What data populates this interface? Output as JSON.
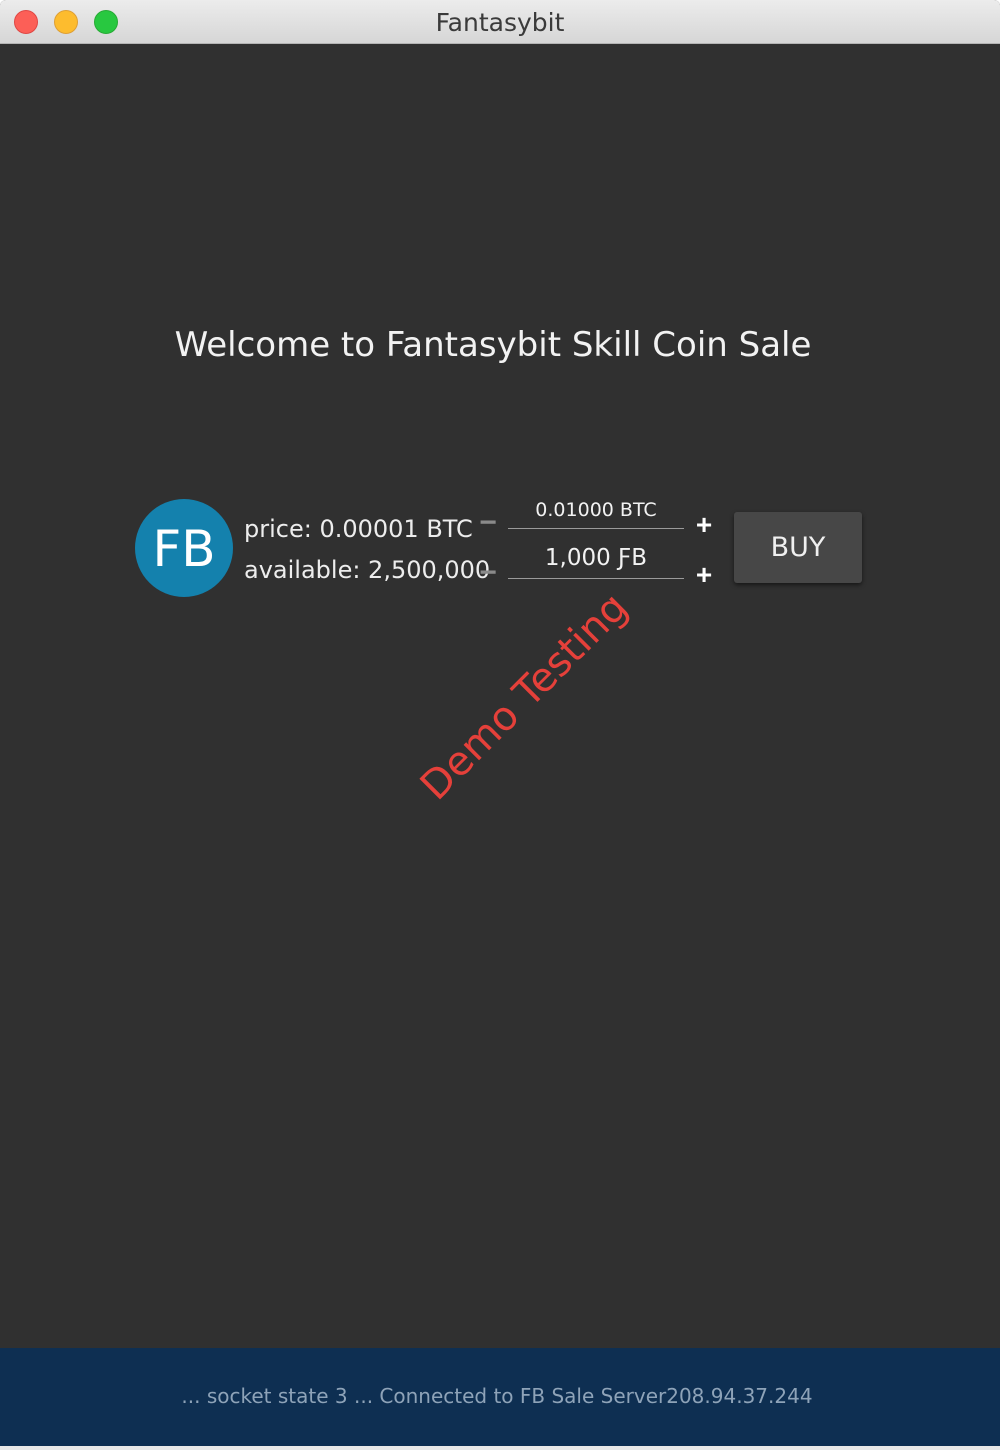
{
  "window": {
    "title": "Fantasybit"
  },
  "main": {
    "welcome": "Welcome to Fantasybit Skill Coin Sale",
    "logo_text": "FB",
    "price_label": "price: 0.00001 BTC",
    "available_label": "available: 2,500,000",
    "btc_amount": "0.01000 BTC",
    "fb_amount": "1,000 ƑB",
    "minus_symbol": "−",
    "plus_symbol": "+",
    "buy_label": "BUY",
    "watermark": "Demo Testing"
  },
  "status": {
    "text": "... socket state 3  ... Connected to FB Sale Server208.94.37.244"
  },
  "colors": {
    "background": "#303030",
    "status_bar": "#0e2f52",
    "logo_circle": "#1481ad",
    "watermark": "#e5403a",
    "buy_button": "#474747"
  },
  "icons": {
    "close": "close-traffic-light-icon",
    "minimize": "minimize-traffic-light-icon",
    "maximize": "maximize-traffic-light-icon",
    "logo": "fantasybit-logo-icon"
  }
}
